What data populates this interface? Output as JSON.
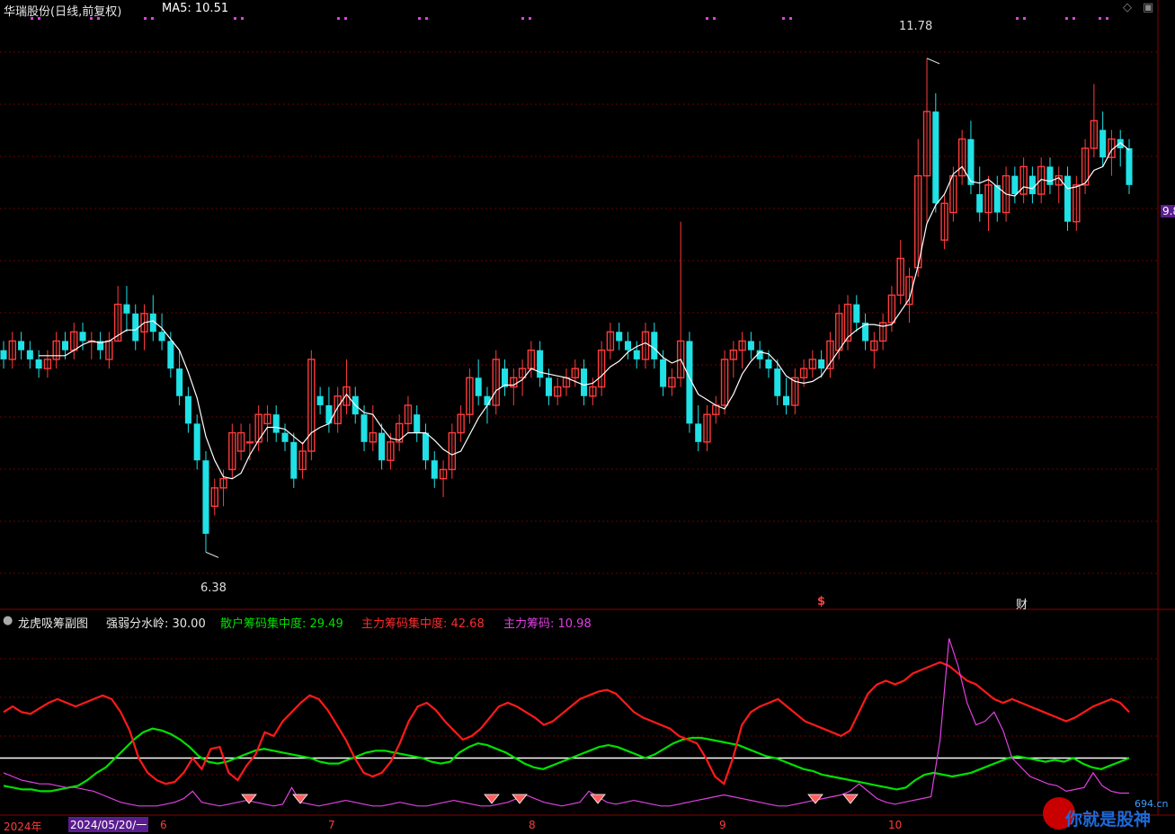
{
  "header": {
    "stock": "华瑞股份(日线,前复权)",
    "ma5_label": "MA5: 10.51",
    "icons": [
      "diamond-icon",
      "window-icon"
    ]
  },
  "right_tag": "9.8",
  "price_annotations": {
    "high": "11.78",
    "low": "6.38"
  },
  "event_markers": {
    "s": "$",
    "cai": "财"
  },
  "sub_header": {
    "title": "龙虎吸筹副图",
    "threshold": "强弱分水岭: 30.00",
    "retail": "散户筹码集中度: 29.49",
    "main": "主力筹码集中度: 42.68",
    "main_chip": "主力筹码: 10.98"
  },
  "xaxis": {
    "year": "2024年",
    "cursor": "2024/05/20/一",
    "m6": "6",
    "m7": "7",
    "m8": "8",
    "m9": "9",
    "m10": "10"
  },
  "watermark": {
    "text": "你就是股神",
    "site": "694.cn"
  },
  "colors": {
    "up": "#ff3b3b",
    "down": "#1fe1e6",
    "ma": "#ffffff",
    "green": "#00e000",
    "red": "#ff1a1a",
    "purple": "#e040e0",
    "grid": "#6b0000"
  },
  "chart_data": [
    {
      "type": "candlestick",
      "title": "华瑞股份(日线,前复权)",
      "ylim": [
        6.1,
        12.2
      ],
      "annotations": {
        "max": 11.78,
        "min": 6.38
      },
      "ma5_last": 10.51,
      "ohlc": [
        [
          8.6,
          8.7,
          8.4,
          8.5
        ],
        [
          8.5,
          8.8,
          8.4,
          8.7
        ],
        [
          8.7,
          8.8,
          8.5,
          8.6
        ],
        [
          8.6,
          8.7,
          8.4,
          8.5
        ],
        [
          8.5,
          8.6,
          8.3,
          8.4
        ],
        [
          8.4,
          8.6,
          8.3,
          8.5
        ],
        [
          8.5,
          8.8,
          8.4,
          8.7
        ],
        [
          8.7,
          8.8,
          8.5,
          8.6
        ],
        [
          8.6,
          8.9,
          8.5,
          8.8
        ],
        [
          8.8,
          8.9,
          8.6,
          8.7
        ],
        [
          8.7,
          8.8,
          8.5,
          8.7
        ],
        [
          8.7,
          8.8,
          8.5,
          8.6
        ],
        [
          8.5,
          8.8,
          8.4,
          8.7
        ],
        [
          8.7,
          9.3,
          8.7,
          9.1
        ],
        [
          9.1,
          9.3,
          8.8,
          9.0
        ],
        [
          9.0,
          9.1,
          8.6,
          8.7
        ],
        [
          8.8,
          9.1,
          8.6,
          9.0
        ],
        [
          9.0,
          9.2,
          8.7,
          8.8
        ],
        [
          8.8,
          9.0,
          8.6,
          8.7
        ],
        [
          8.7,
          8.8,
          8.3,
          8.4
        ],
        [
          8.4,
          8.6,
          8.0,
          8.1
        ],
        [
          8.1,
          8.2,
          7.7,
          7.8
        ],
        [
          7.8,
          7.9,
          7.3,
          7.4
        ],
        [
          7.4,
          7.5,
          6.4,
          6.6
        ],
        [
          6.9,
          7.2,
          6.8,
          7.1
        ],
        [
          7.1,
          7.3,
          6.9,
          7.2
        ],
        [
          7.3,
          7.8,
          7.2,
          7.7
        ],
        [
          7.5,
          7.8,
          7.4,
          7.7
        ],
        [
          7.6,
          7.8,
          7.4,
          7.6
        ],
        [
          7.6,
          8.0,
          7.5,
          7.9
        ],
        [
          7.8,
          8.0,
          7.6,
          7.9
        ],
        [
          7.9,
          8.0,
          7.6,
          7.7
        ],
        [
          7.7,
          7.8,
          7.5,
          7.6
        ],
        [
          7.6,
          7.7,
          7.1,
          7.2
        ],
        [
          7.3,
          7.6,
          7.2,
          7.5
        ],
        [
          7.5,
          8.6,
          7.4,
          8.5
        ],
        [
          8.1,
          8.2,
          7.9,
          8.0
        ],
        [
          8.0,
          8.2,
          7.7,
          7.8
        ],
        [
          7.8,
          8.2,
          7.7,
          8.1
        ],
        [
          8.0,
          8.5,
          7.9,
          8.2
        ],
        [
          8.1,
          8.2,
          7.8,
          7.9
        ],
        [
          7.9,
          8.0,
          7.5,
          7.6
        ],
        [
          7.6,
          8.0,
          7.5,
          7.7
        ],
        [
          7.7,
          7.8,
          7.3,
          7.4
        ],
        [
          7.4,
          7.7,
          7.3,
          7.6
        ],
        [
          7.6,
          7.9,
          7.5,
          7.8
        ],
        [
          7.8,
          8.1,
          7.7,
          8.0
        ],
        [
          7.9,
          8.0,
          7.6,
          7.7
        ],
        [
          7.7,
          7.8,
          7.3,
          7.4
        ],
        [
          7.4,
          7.5,
          7.1,
          7.2
        ],
        [
          7.2,
          7.4,
          7.0,
          7.3
        ],
        [
          7.3,
          7.8,
          7.2,
          7.7
        ],
        [
          7.7,
          8.0,
          7.6,
          7.9
        ],
        [
          7.9,
          8.4,
          7.8,
          8.3
        ],
        [
          8.3,
          8.5,
          8.0,
          8.1
        ],
        [
          8.1,
          8.2,
          7.8,
          8.0
        ],
        [
          8.0,
          8.6,
          7.9,
          8.5
        ],
        [
          8.4,
          8.5,
          8.1,
          8.2
        ],
        [
          8.2,
          8.4,
          8.0,
          8.3
        ],
        [
          8.3,
          8.5,
          8.1,
          8.4
        ],
        [
          8.4,
          8.7,
          8.3,
          8.6
        ],
        [
          8.6,
          8.7,
          8.2,
          8.3
        ],
        [
          8.3,
          8.4,
          8.0,
          8.1
        ],
        [
          8.1,
          8.3,
          8.0,
          8.2
        ],
        [
          8.2,
          8.4,
          8.1,
          8.3
        ],
        [
          8.3,
          8.5,
          8.2,
          8.4
        ],
        [
          8.4,
          8.5,
          8.0,
          8.1
        ],
        [
          8.1,
          8.3,
          8.0,
          8.2
        ],
        [
          8.2,
          8.7,
          8.1,
          8.6
        ],
        [
          8.6,
          8.9,
          8.5,
          8.8
        ],
        [
          8.8,
          8.9,
          8.6,
          8.7
        ],
        [
          8.7,
          8.8,
          8.5,
          8.6
        ],
        [
          8.6,
          8.7,
          8.4,
          8.5
        ],
        [
          8.5,
          8.9,
          8.4,
          8.8
        ],
        [
          8.8,
          8.9,
          8.4,
          8.5
        ],
        [
          8.5,
          8.6,
          8.1,
          8.2
        ],
        [
          8.2,
          8.4,
          8.1,
          8.3
        ],
        [
          8.3,
          10.0,
          8.2,
          8.7
        ],
        [
          8.7,
          8.8,
          7.7,
          7.8
        ],
        [
          7.8,
          8.0,
          7.5,
          7.6
        ],
        [
          7.6,
          8.0,
          7.5,
          7.9
        ],
        [
          7.9,
          8.1,
          7.8,
          8.0
        ],
        [
          8.0,
          8.6,
          7.9,
          8.5
        ],
        [
          8.5,
          8.7,
          8.3,
          8.6
        ],
        [
          8.6,
          8.8,
          8.4,
          8.7
        ],
        [
          8.7,
          8.8,
          8.5,
          8.6
        ],
        [
          8.6,
          8.7,
          8.4,
          8.5
        ],
        [
          8.5,
          8.6,
          8.3,
          8.4
        ],
        [
          8.4,
          8.5,
          8.0,
          8.1
        ],
        [
          8.1,
          8.3,
          7.9,
          8.0
        ],
        [
          8.0,
          8.4,
          7.9,
          8.3
        ],
        [
          8.3,
          8.5,
          8.2,
          8.4
        ],
        [
          8.4,
          8.6,
          8.3,
          8.5
        ],
        [
          8.5,
          8.6,
          8.3,
          8.4
        ],
        [
          8.4,
          8.8,
          8.3,
          8.7
        ],
        [
          8.6,
          9.1,
          8.5,
          9.0
        ],
        [
          8.7,
          9.2,
          8.6,
          9.1
        ],
        [
          9.1,
          9.2,
          8.8,
          8.9
        ],
        [
          8.9,
          9.0,
          8.6,
          8.7
        ],
        [
          8.6,
          8.8,
          8.4,
          8.7
        ],
        [
          8.7,
          9.0,
          8.6,
          8.9
        ],
        [
          8.9,
          9.3,
          8.8,
          9.2
        ],
        [
          9.2,
          9.8,
          9.1,
          9.6
        ],
        [
          9.1,
          9.5,
          8.9,
          9.4
        ],
        [
          9.5,
          10.9,
          9.4,
          10.5
        ],
        [
          10.5,
          11.78,
          10.0,
          11.2
        ],
        [
          11.2,
          11.4,
          10.1,
          10.2
        ],
        [
          9.8,
          10.3,
          9.7,
          10.2
        ],
        [
          10.1,
          10.6,
          10.0,
          10.5
        ],
        [
          10.5,
          11.0,
          10.4,
          10.9
        ],
        [
          10.9,
          11.1,
          10.3,
          10.4
        ],
        [
          10.3,
          10.6,
          10.0,
          10.1
        ],
        [
          10.1,
          10.5,
          9.9,
          10.4
        ],
        [
          10.4,
          10.5,
          10.0,
          10.1
        ],
        [
          10.1,
          10.6,
          10.0,
          10.5
        ],
        [
          10.5,
          10.6,
          10.2,
          10.3
        ],
        [
          10.3,
          10.7,
          10.2,
          10.6
        ],
        [
          10.5,
          10.6,
          10.2,
          10.3
        ],
        [
          10.3,
          10.7,
          10.2,
          10.6
        ],
        [
          10.6,
          10.7,
          10.3,
          10.4
        ],
        [
          10.4,
          10.6,
          10.2,
          10.5
        ],
        [
          10.5,
          10.6,
          9.9,
          10.0
        ],
        [
          10.0,
          10.5,
          9.9,
          10.4
        ],
        [
          10.4,
          10.9,
          10.3,
          10.8
        ],
        [
          10.8,
          11.5,
          10.7,
          11.1
        ],
        [
          11.0,
          11.2,
          10.6,
          10.7
        ],
        [
          10.7,
          11.0,
          10.5,
          10.9
        ],
        [
          10.9,
          11.0,
          10.6,
          10.8
        ],
        [
          10.8,
          10.9,
          10.3,
          10.4
        ]
      ]
    },
    {
      "type": "line",
      "title": "龙虎吸筹副图",
      "ylim": [
        0,
        100
      ],
      "threshold": 30.0,
      "series": [
        {
          "name": "散户筹码集中度",
          "last": 29.49,
          "values": [
            15,
            14,
            13,
            13,
            12,
            12,
            13,
            14,
            15,
            18,
            22,
            25,
            30,
            35,
            40,
            44,
            46,
            45,
            43,
            40,
            36,
            31,
            28,
            27,
            28,
            30,
            32,
            34,
            35,
            34,
            33,
            32,
            31,
            30,
            28,
            27,
            27,
            29,
            31,
            33,
            34,
            34,
            33,
            32,
            31,
            30,
            28,
            27,
            28,
            33,
            36,
            38,
            37,
            35,
            33,
            30,
            27,
            25,
            24,
            26,
            28,
            30,
            32,
            34,
            36,
            37,
            36,
            34,
            32,
            30,
            32,
            35,
            38,
            40,
            41,
            41,
            40,
            39,
            38,
            37,
            35,
            33,
            31,
            30,
            28,
            26,
            24,
            23,
            21,
            20,
            19,
            18,
            17,
            16,
            15,
            14,
            13,
            14,
            18,
            21,
            22,
            21,
            20,
            21,
            22,
            24,
            26,
            28,
            30,
            31,
            30,
            29,
            28,
            29,
            28,
            30,
            27,
            25,
            24,
            26,
            28,
            30
          ]
        },
        {
          "name": "主力筹码集中度",
          "last": 42.68,
          "values": [
            55,
            58,
            55,
            54,
            57,
            60,
            62,
            60,
            58,
            60,
            62,
            64,
            62,
            55,
            45,
            30,
            22,
            18,
            16,
            17,
            22,
            30,
            24,
            35,
            36,
            22,
            18,
            26,
            32,
            44,
            42,
            50,
            55,
            60,
            64,
            62,
            56,
            48,
            40,
            30,
            22,
            20,
            22,
            28,
            38,
            50,
            58,
            60,
            56,
            50,
            45,
            40,
            42,
            46,
            52,
            58,
            60,
            58,
            55,
            52,
            48,
            50,
            54,
            58,
            62,
            64,
            66,
            67,
            65,
            60,
            55,
            52,
            50,
            48,
            46,
            42,
            40,
            38,
            30,
            20,
            16,
            30,
            48,
            55,
            58,
            60,
            62,
            58,
            54,
            50,
            48,
            46,
            44,
            42,
            45,
            55,
            65,
            70,
            72,
            70,
            72,
            76,
            78,
            80,
            82,
            80,
            76,
            72,
            70,
            66,
            62,
            60,
            62,
            60,
            58,
            56,
            54,
            52,
            50,
            52,
            55,
            58,
            60,
            62,
            60,
            55
          ]
        },
        {
          "name": "主力筹码",
          "last": 10.98,
          "values": [
            22,
            20,
            18,
            17,
            16,
            16,
            15,
            14,
            14,
            13,
            12,
            10,
            8,
            6,
            5,
            4,
            4,
            4,
            5,
            6,
            8,
            12,
            6,
            5,
            4,
            5,
            6,
            7,
            6,
            5,
            4,
            5,
            14,
            6,
            5,
            4,
            5,
            6,
            7,
            6,
            5,
            4,
            4,
            5,
            6,
            5,
            4,
            4,
            5,
            6,
            7,
            6,
            5,
            4,
            4,
            5,
            6,
            8,
            10,
            8,
            6,
            5,
            4,
            5,
            6,
            12,
            9,
            6,
            5,
            6,
            7,
            6,
            5,
            4,
            4,
            5,
            6,
            7,
            8,
            9,
            10,
            9,
            8,
            7,
            6,
            5,
            4,
            4,
            5,
            6,
            7,
            8,
            9,
            10,
            12,
            16,
            12,
            8,
            6,
            5,
            6,
            7,
            8,
            9,
            40,
            95,
            80,
            60,
            48,
            50,
            55,
            45,
            30,
            25,
            20,
            18,
            16,
            15,
            12,
            13,
            14,
            22,
            15,
            12,
            11,
            11
          ]
        }
      ]
    }
  ]
}
